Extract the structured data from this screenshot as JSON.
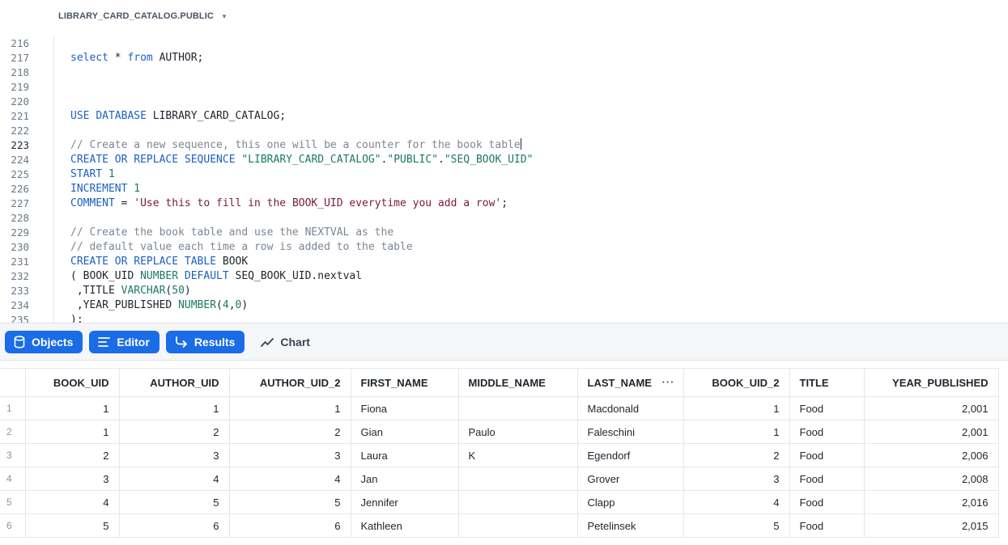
{
  "context": {
    "label": "LIBRARY_CARD_CATALOG.PUBLIC",
    "caret_icon": "caret-down-icon"
  },
  "editor": {
    "line_numbers": [
      "216",
      "217",
      "218",
      "219",
      "220",
      "221",
      "222",
      "223",
      "224",
      "225",
      "226",
      "227",
      "228",
      "229",
      "230",
      "231",
      "232",
      "233",
      "234",
      "235"
    ],
    "active_line": "223",
    "lines": [
      "",
      "select * from AUTHOR;",
      "",
      "",
      "",
      "USE DATABASE LIBRARY_CARD_CATALOG;",
      "",
      "// Create a new sequence, this one will be a counter for the book table",
      "CREATE OR REPLACE SEQUENCE \"LIBRARY_CARD_CATALOG\".\"PUBLIC\".\"SEQ_BOOK_UID\"",
      "START 1",
      "INCREMENT 1",
      "COMMENT = 'Use this to fill in the BOOK_UID everytime you add a row';",
      "",
      "// Create the book table and use the NEXTVAL as the",
      "// default value each time a row is added to the table",
      "CREATE OR REPLACE TABLE BOOK",
      "( BOOK_UID NUMBER DEFAULT SEQ_BOOK_UID.nextval",
      " ,TITLE VARCHAR(50)",
      " ,YEAR_PUBLISHED NUMBER(4,0)",
      ");"
    ]
  },
  "toolbar": {
    "objects_label": "Objects",
    "editor_label": "Editor",
    "results_label": "Results",
    "chart_label": "Chart",
    "accent": "#1a6ce7"
  },
  "results": {
    "columns": [
      "BOOK_UID",
      "AUTHOR_UID",
      "AUTHOR_UID_2",
      "FIRST_NAME",
      "MIDDLE_NAME",
      "LAST_NAME",
      "BOOK_UID_2",
      "TITLE",
      "YEAR_PUBLISHED"
    ],
    "column_menu_label": "···",
    "rows": [
      {
        "n": "1",
        "cells": [
          "1",
          "1",
          "1",
          "Fiona",
          "",
          "Macdonald",
          "1",
          "Food",
          "2,001"
        ]
      },
      {
        "n": "2",
        "cells": [
          "1",
          "2",
          "2",
          "Gian",
          "Paulo",
          "Faleschini",
          "1",
          "Food",
          "2,001"
        ]
      },
      {
        "n": "3",
        "cells": [
          "2",
          "3",
          "3",
          "Laura",
          "K",
          "Egendorf",
          "2",
          "Food",
          "2,006"
        ]
      },
      {
        "n": "4",
        "cells": [
          "3",
          "4",
          "4",
          "Jan",
          "",
          "Grover",
          "3",
          "Food",
          "2,008"
        ]
      },
      {
        "n": "5",
        "cells": [
          "4",
          "5",
          "5",
          "Jennifer",
          "",
          "Clapp",
          "4",
          "Food",
          "2,016"
        ]
      },
      {
        "n": "6",
        "cells": [
          "5",
          "6",
          "6",
          "Kathleen",
          "",
          "Petelinsek",
          "5",
          "Food",
          "2,015"
        ]
      }
    ]
  }
}
